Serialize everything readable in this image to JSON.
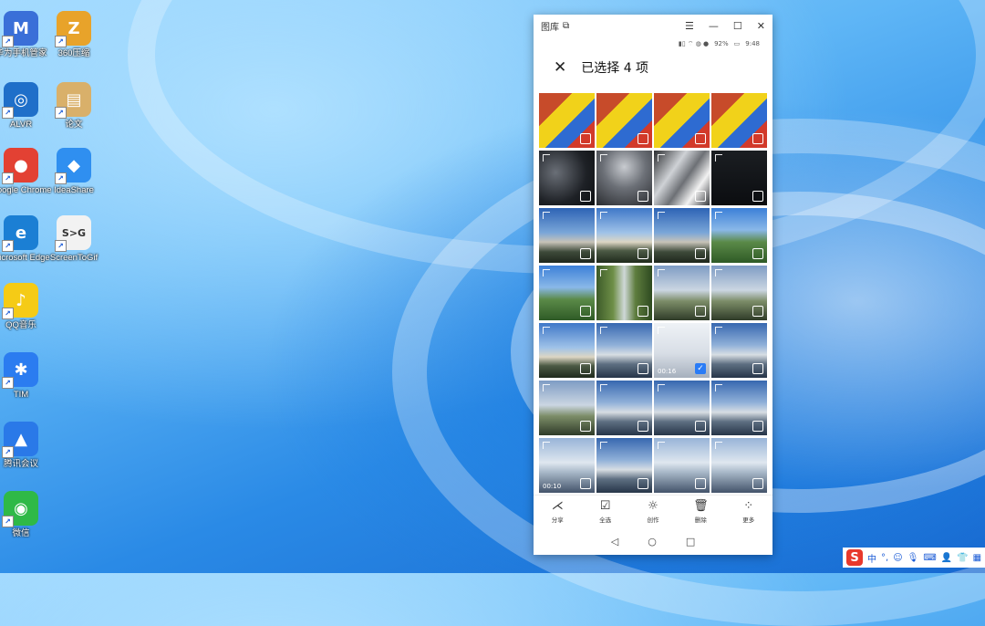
{
  "desktop": {
    "icons": [
      {
        "label": "华为手机管家",
        "glyph": "M",
        "color": "#3a6fd8"
      },
      {
        "label": "360压缩",
        "glyph": "Z",
        "color": "#e8a32a"
      },
      {
        "label": "ALVR",
        "glyph": "◎",
        "color": "#1f6fc9"
      },
      {
        "label": "论文",
        "glyph": "▤",
        "color": "#d9b06a"
      },
      {
        "label": "Google Chrome",
        "glyph": "●",
        "color": "#e34133"
      },
      {
        "label": "IdeaShare",
        "glyph": "◆",
        "color": "#2f8ff0"
      },
      {
        "label": "Microsoft Edge",
        "glyph": "e",
        "color": "#1b7fd4"
      },
      {
        "label": "ScreenToGif",
        "glyph": "S>G",
        "color": "#f2f2f2"
      },
      {
        "label": "QQ音乐",
        "glyph": "♪",
        "color": "#f5cb16"
      },
      {
        "label": "TIM",
        "glyph": "✱",
        "color": "#2b7cf0"
      },
      {
        "label": "腾讯会议",
        "glyph": "▲",
        "color": "#2a79e8"
      },
      {
        "label": "微信",
        "glyph": "◉",
        "color": "#2fb947"
      }
    ]
  },
  "window": {
    "title": "图库",
    "status": {
      "battery": "92%",
      "time": "9:48"
    },
    "header_title": "已选择 4 项",
    "thumbnails": [
      {
        "style": "t-cube",
        "checked": false,
        "duration": ""
      },
      {
        "style": "t-cube",
        "checked": false,
        "duration": ""
      },
      {
        "style": "t-cube",
        "checked": false,
        "duration": ""
      },
      {
        "style": "t-cube",
        "checked": false,
        "duration": ""
      },
      {
        "style": "t-night",
        "checked": false,
        "duration": ""
      },
      {
        "style": "t-night2",
        "checked": false,
        "duration": ""
      },
      {
        "style": "t-trail",
        "checked": false,
        "duration": ""
      },
      {
        "style": "t-dark",
        "checked": false,
        "duration": ""
      },
      {
        "style": "t-sky",
        "checked": false,
        "duration": ""
      },
      {
        "style": "t-sky2",
        "checked": false,
        "duration": ""
      },
      {
        "style": "t-sky",
        "checked": false,
        "duration": ""
      },
      {
        "style": "t-green",
        "checked": false,
        "duration": ""
      },
      {
        "style": "t-green",
        "checked": false,
        "duration": ""
      },
      {
        "style": "t-road",
        "checked": false,
        "duration": ""
      },
      {
        "style": "t-valley",
        "checked": false,
        "duration": ""
      },
      {
        "style": "t-valley",
        "checked": false,
        "duration": ""
      },
      {
        "style": "t-sky2",
        "checked": false,
        "duration": ""
      },
      {
        "style": "t-sea",
        "checked": false,
        "duration": ""
      },
      {
        "style": "t-sel",
        "checked": true,
        "duration": "00:16"
      },
      {
        "style": "t-sea",
        "checked": false,
        "duration": ""
      },
      {
        "style": "t-valley",
        "checked": false,
        "duration": ""
      },
      {
        "style": "t-sea",
        "checked": false,
        "duration": ""
      },
      {
        "style": "t-sea",
        "checked": false,
        "duration": ""
      },
      {
        "style": "t-sea",
        "checked": false,
        "duration": ""
      },
      {
        "style": "t-cloud",
        "checked": false,
        "duration": "00:10"
      },
      {
        "style": "t-sea",
        "checked": false,
        "duration": ""
      },
      {
        "style": "t-cloud",
        "checked": false,
        "duration": ""
      },
      {
        "style": "t-cloud",
        "checked": false,
        "duration": ""
      },
      {
        "style": "t-sea",
        "checked": false,
        "duration": ""
      },
      {
        "style": "t-cloud",
        "checked": false,
        "duration": ""
      },
      {
        "style": "t-sea",
        "checked": false,
        "duration": ""
      },
      {
        "style": "t-sel",
        "checked": false,
        "duration": ""
      }
    ],
    "actions": [
      {
        "label": "分享",
        "icon": "share-icon",
        "glyph": "⋌"
      },
      {
        "label": "全选",
        "icon": "select-all-icon",
        "glyph": "☑"
      },
      {
        "label": "创作",
        "icon": "bulb-icon",
        "glyph": "☼"
      },
      {
        "label": "删除",
        "icon": "trash-icon",
        "glyph": "🗑"
      },
      {
        "label": "更多",
        "icon": "more-icon",
        "glyph": "⁘"
      }
    ]
  },
  "accent": "#2a7cf6"
}
